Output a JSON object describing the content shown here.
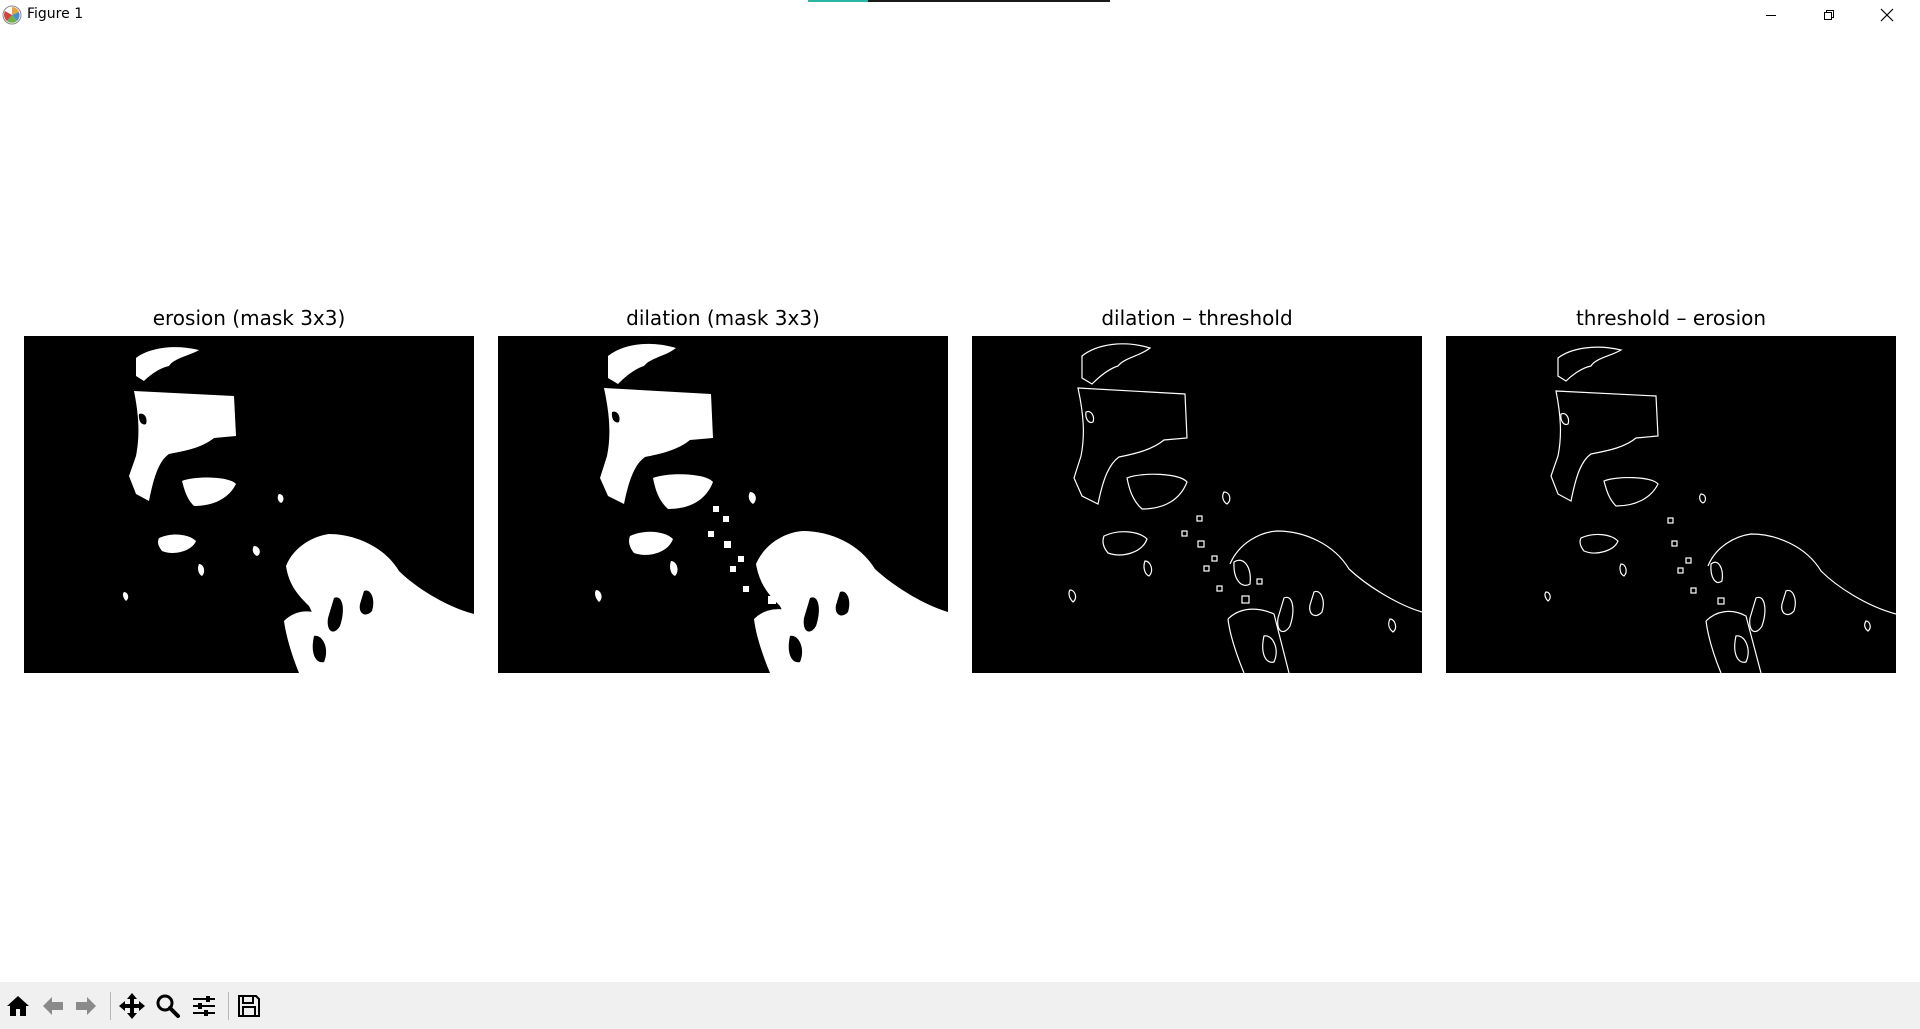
{
  "window": {
    "title": "Figure 1",
    "progress_fraction": 0.2
  },
  "figure": {
    "subplots": [
      {
        "title": "erosion (mask 3x3)",
        "style": "filled"
      },
      {
        "title": "dilation (mask 3x3)",
        "style": "filled"
      },
      {
        "title": "dilation – threshold",
        "style": "outline"
      },
      {
        "title": "threshold – erosion",
        "style": "outline"
      }
    ]
  },
  "toolbar": {
    "buttons": [
      "home-icon",
      "back-arrow-icon",
      "forward-arrow-icon",
      "pan-icon",
      "zoom-icon",
      "configure-subplots-icon",
      "save-icon"
    ]
  },
  "colors": {
    "panel_background": "#000000",
    "foreground": "#ffffff",
    "toolbar_background": "#f0f0f0",
    "progress_accent": "#2bb5a5"
  }
}
